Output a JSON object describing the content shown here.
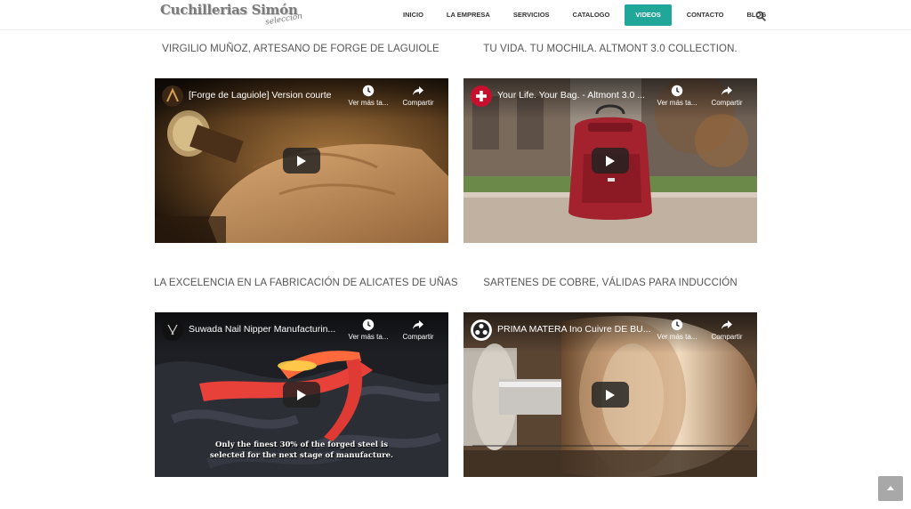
{
  "header": {
    "logo_main": "Cuchillerias Simón",
    "logo_sub": "selección",
    "nav": [
      "INICIO",
      "LA EMPRESA",
      "SERVICIOS",
      "CATALOGO",
      "VIDEOS",
      "CONTACTO",
      "BLOG"
    ],
    "active_nav": "VIDEOS",
    "search_icon": "search-icon"
  },
  "sections": [
    {
      "title": "VIRGILIO MUÑOZ, ARTESANO DE FORGE DE LAGUIOLE",
      "video": {
        "title": "[Forge de Laguiole] Version courte",
        "watch_later": "Ver más ta...",
        "share": "Compartir",
        "caption": ""
      }
    },
    {
      "title": "TU VIDA. TU MOCHILA. ALTMONT 3.0 COLLECTION.",
      "video": {
        "title": "Your Life. Your Bag. - Altmont 3.0 ...",
        "watch_later": "Ver más ta...",
        "share": "Compartir",
        "caption": ""
      }
    },
    {
      "title": "LA EXCELENCIA EN LA FABRICACIÓN DE ALICATES DE UÑAS",
      "video": {
        "title": "Suwada Nail Nipper Manufacturin...",
        "watch_later": "Ver más ta...",
        "share": "Compartir",
        "caption_line1": "Only the finest 30% of the forged steel is",
        "caption_line2": "selected for the next stage of manufacture."
      }
    },
    {
      "title": "SARTENES DE COBRE, VÁLIDAS PARA INDUCCIÓN",
      "video": {
        "title": "PRIMA MATERA Ino Cuivre DE BU...",
        "watch_later": "Ver más ta...",
        "share": "Compartir",
        "caption": ""
      }
    }
  ],
  "colors": {
    "accent": "#21a79a",
    "scroll_button": "#a8a8a8"
  }
}
